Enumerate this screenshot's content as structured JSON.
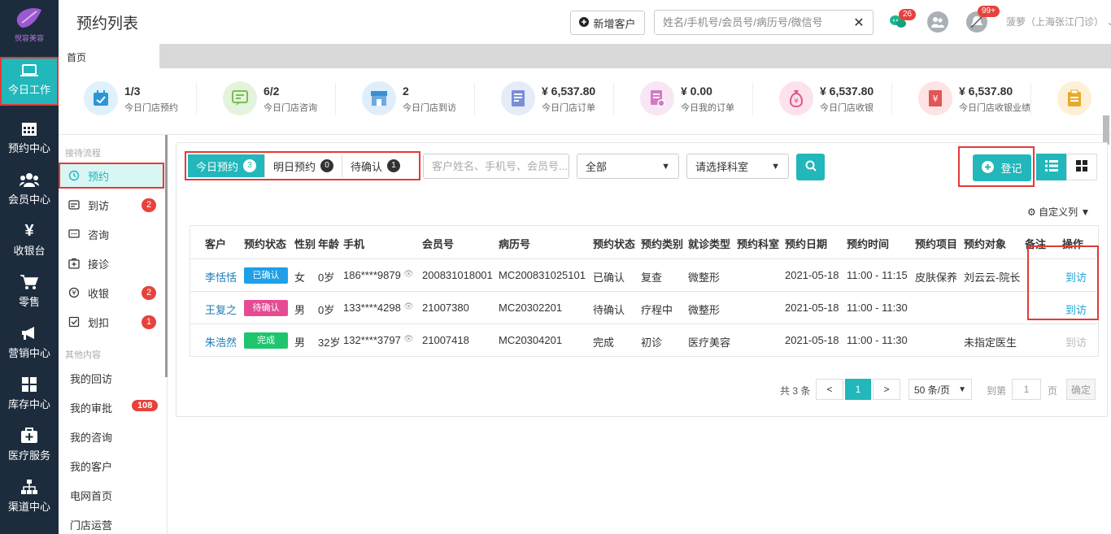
{
  "app": {
    "logo_text": "悦容美容",
    "page_title": "预约列表"
  },
  "header": {
    "new_customer_label": "新增客户",
    "search_placeholder": "姓名/手机号/会员号/病历号/微信号",
    "chat_badge": "26",
    "alert_badge": "99+",
    "user_name": "菠萝（上海张江门诊）"
  },
  "nav": [
    {
      "label": "今日工作",
      "icon": "laptop-icon",
      "active": true
    },
    {
      "label": "预约中心",
      "icon": "calendar-icon"
    },
    {
      "label": "会员中心",
      "icon": "users-icon"
    },
    {
      "label": "收银台",
      "icon": "yen-icon"
    },
    {
      "label": "零售",
      "icon": "cart-icon"
    },
    {
      "label": "营销中心",
      "icon": "megaphone-icon"
    },
    {
      "label": "库存中心",
      "icon": "grid-icon"
    },
    {
      "label": "医疗服务",
      "icon": "medkit-icon"
    },
    {
      "label": "渠道中心",
      "icon": "sitemap-icon"
    }
  ],
  "tabs": {
    "home": "首页"
  },
  "stats": [
    {
      "value": "1/3",
      "label": "今日门店预约",
      "icon": "calendar-check-icon",
      "color": "#dff1fb",
      "fg": "#2a98d6"
    },
    {
      "value": "6/2",
      "label": "今日门店咨询",
      "icon": "chat-edit-icon",
      "color": "#e4f3dd",
      "fg": "#7bbf4f"
    },
    {
      "value": "2",
      "label": "今日门店到访",
      "icon": "store-icon",
      "color": "#dfeefa",
      "fg": "#3a8fd6"
    },
    {
      "value": "¥ 6,537.80",
      "label": "今日门店订单",
      "icon": "document-icon",
      "color": "#e6ebf8",
      "fg": "#7b8ed8"
    },
    {
      "value": "¥ 0.00",
      "label": "今日我的订单",
      "icon": "my-order-icon",
      "color": "#f8e6f4",
      "fg": "#d27bc2"
    },
    {
      "value": "¥ 6,537.80",
      "label": "今日门店收银",
      "icon": "money-bag-icon",
      "color": "#fbe2ec",
      "fg": "#e4548e"
    },
    {
      "value": "¥ 6,537.80",
      "label": "今日门店收银业绩",
      "icon": "receipt-icon",
      "color": "#fde3e3",
      "fg": "#e25656"
    },
    {
      "value": "",
      "label": "",
      "icon": "clipboard-icon",
      "color": "#fdf0d6",
      "fg": "#e8a92b"
    }
  ],
  "sidebar": {
    "section1": "接待流程",
    "items": [
      {
        "label": "预约",
        "icon": "clock-icon",
        "count": null,
        "active": true
      },
      {
        "label": "到访",
        "icon": "id-card-icon",
        "count": "2"
      },
      {
        "label": "咨询",
        "icon": "comment-icon",
        "count": null
      },
      {
        "label": "接诊",
        "icon": "plus-square-icon",
        "count": null
      },
      {
        "label": "收银",
        "icon": "yen-circle-icon",
        "count": "2"
      },
      {
        "label": "划扣",
        "icon": "check-square-icon",
        "count": "1"
      }
    ],
    "section2": "其他内容",
    "others": [
      {
        "label": "我的回访"
      },
      {
        "label": "我的审批",
        "count": "108"
      },
      {
        "label": "我的咨询"
      },
      {
        "label": "我的客户"
      },
      {
        "label": "电网首页"
      },
      {
        "label": "门店运营"
      }
    ]
  },
  "filters": {
    "tabs": [
      {
        "label": "今日预约",
        "count": "3",
        "active": true
      },
      {
        "label": "明日预约",
        "count": "0"
      },
      {
        "label": "待确认",
        "count": "1"
      }
    ],
    "search_placeholder": "客户姓名、手机号、会员号...",
    "status_select": "全部",
    "dept_select": "请选择科室",
    "register_label": "登记",
    "custom_columns_label": "自定义列"
  },
  "table": {
    "headers": [
      "客户",
      "预约状态",
      "性别",
      "年龄",
      "手机",
      "会员号",
      "病历号",
      "预约状态",
      "预约类别",
      "就诊类型",
      "预约科室",
      "预约日期",
      "预约时间",
      "预约项目",
      "预约对象",
      "备注",
      "操作"
    ],
    "rows": [
      {
        "name": "李恬恬",
        "status": "已确认",
        "status_color": "#1e9fe8",
        "gender": "女",
        "age": "0岁",
        "phone": "186****9879",
        "member": "200831018001",
        "record": "MC200831025101",
        "status2": "已确认",
        "category": "复查",
        "visit_type": "微整形",
        "dept": "",
        "date": "2021-05-18",
        "time": "11:00 - 11:15",
        "project": "皮肤保养",
        "target": "刘云云-院长",
        "remark": "",
        "action": "到访",
        "action_enabled": true
      },
      {
        "name": "王复之",
        "status": "待确认",
        "status_color": "#e74a94",
        "gender": "男",
        "age": "0岁",
        "phone": "133****4298",
        "member": "21007380",
        "record": "MC20302201",
        "status2": "待确认",
        "category": "疗程中",
        "visit_type": "微整形",
        "dept": "",
        "date": "2021-05-18",
        "time": "11:00 - 11:30",
        "project": "",
        "target": "",
        "remark": "",
        "action": "到访",
        "action_enabled": true
      },
      {
        "name": "朱浩然",
        "status": "完成",
        "status_color": "#1fc56e",
        "gender": "男",
        "age": "32岁",
        "phone": "132****3797",
        "member": "21007418",
        "record": "MC20304201",
        "status2": "完成",
        "category": "初诊",
        "visit_type": "医疗美容",
        "dept": "",
        "date": "2021-05-18",
        "time": "11:00 - 11:30",
        "project": "",
        "target": "未指定医生",
        "remark": "",
        "action": "到访",
        "action_enabled": false
      }
    ]
  },
  "pagination": {
    "total": "共 3 条",
    "prev": "<",
    "current": "1",
    "next": ">",
    "page_size": "50 条/页",
    "goto_label": "到第",
    "goto_value": "1",
    "page_unit": "页",
    "confirm": "确定"
  }
}
